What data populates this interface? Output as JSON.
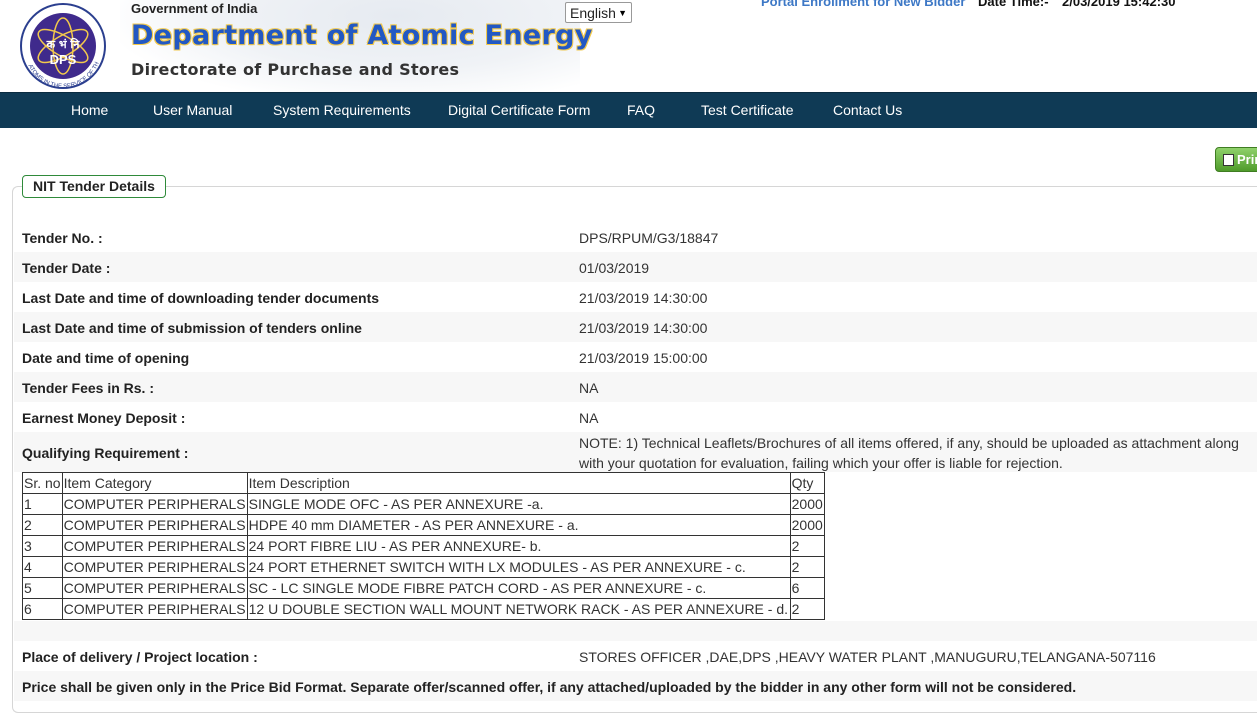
{
  "header": {
    "gov": "Government of India",
    "dept": "Department of Atomic Energy",
    "directorate": "Directorate of Purchase and Stores",
    "logo": {
      "center_text": "DPS",
      "top_text": "क भं नि",
      "ring_text": "ATOMS IN THE SERVICE OF THE NATION",
      "colors": {
        "ring": "#2b3f8f",
        "center": "#3f2a8c",
        "accent": "#f2c94c"
      }
    },
    "language": "English",
    "portal_link": "Portal Enrollment for New Bidder",
    "datetime_label": "Date Time:-",
    "datetime_value": "2/03/2019 15:42:30"
  },
  "nav": [
    "Home",
    "User Manual",
    "System Requirements",
    "Digital Certificate Form",
    "FAQ",
    "Test Certificate",
    "Contact Us"
  ],
  "print_label": "Print",
  "section_title": "NIT Tender Details",
  "details": [
    {
      "label": "Tender No. :",
      "value": "DPS/RPUM/G3/18847"
    },
    {
      "label": "Tender Date :",
      "value": "01/03/2019"
    },
    {
      "label": "Last Date and time of downloading tender documents",
      "value": "21/03/2019 14:30:00"
    },
    {
      "label": "Last Date and time of submission of tenders online",
      "value": "21/03/2019 14:30:00"
    },
    {
      "label": "Date and time of opening",
      "value": "21/03/2019 15:00:00"
    },
    {
      "label": "Tender Fees in Rs. :",
      "value": "NA"
    },
    {
      "label": "Earnest Money Deposit :",
      "value": "NA"
    }
  ],
  "qualifying": {
    "label": "Qualifying Requirement :",
    "note": "NOTE: 1) Technical Leaflets/Brochures of all items offered, if any, should be uploaded as attachment along with your quotation for evaluation, failing which your offer is liable for rejection."
  },
  "items_table": {
    "headers": [
      "Sr. no",
      "Item Category",
      "Item Description",
      "Qty"
    ],
    "rows": [
      [
        "1",
        "COMPUTER PERIPHERALS",
        "SINGLE MODE OFC - AS PER ANNEXURE -a.",
        "2000"
      ],
      [
        "2",
        "COMPUTER PERIPHERALS",
        "HDPE 40 mm DIAMETER - AS PER ANNEXURE - a.",
        "2000"
      ],
      [
        "3",
        "COMPUTER PERIPHERALS",
        "24 PORT FIBRE LIU - AS PER ANNEXURE- b.",
        "2"
      ],
      [
        "4",
        "COMPUTER PERIPHERALS",
        "24 PORT ETHERNET SWITCH WITH LX MODULES - AS PER ANNEXURE - c.",
        "2"
      ],
      [
        "5",
        "COMPUTER PERIPHERALS",
        "SC - LC SINGLE MODE FIBRE PATCH CORD - AS PER ANNEXURE - c.",
        "6"
      ],
      [
        "6",
        "COMPUTER PERIPHERALS",
        "12 U DOUBLE SECTION WALL MOUNT NETWORK RACK - AS PER ANNEXURE - d.",
        "2"
      ]
    ]
  },
  "delivery": {
    "label": "Place of delivery / Project location :",
    "value": "STORES OFFICER ,DAE,DPS ,HEAVY WATER PLANT ,MANUGURU,TELANGANA-507116"
  },
  "price_note": "Price shall be given only in the Price Bid Format. Separate offer/scanned offer, if any attached/uploaded by the bidder in any other form will not be considered."
}
